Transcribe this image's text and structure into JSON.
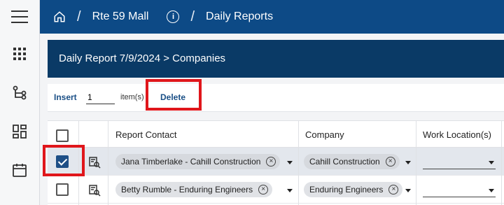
{
  "breadcrumb": {
    "project": "Rte 59 Mall",
    "page": "Daily Reports",
    "sep": "/"
  },
  "page_title": "Daily Report 7/9/2024 > Companies",
  "toolbar": {
    "insert_label": "Insert",
    "quantity": "1",
    "items_label": "item(s)",
    "delete_label": "Delete"
  },
  "table": {
    "columns": [
      "Report Contact",
      "Company",
      "Work Location(s)"
    ],
    "rows": [
      {
        "selected": true,
        "contact": "Jana Timberlake  - Cahill Construction",
        "company": "Cahill Construction",
        "work_location": ""
      },
      {
        "selected": false,
        "contact": "Betty Rumble - Enduring Engineers",
        "company": "Enduring Engineers",
        "work_location": ""
      }
    ]
  },
  "icons": {
    "menu": "hamburger-menu-icon",
    "home": "home-icon",
    "info": "info-icon",
    "sidebar": [
      "apps-grid-icon",
      "hierarchy-icon",
      "dashboard-icon",
      "calendar-icon"
    ],
    "row_action": "view-details-icon",
    "chip_remove": "remove-circle-icon",
    "dropdown": "caret-down-icon"
  },
  "colors": {
    "topbar": "#0d4a86",
    "header": "#0a3a66",
    "highlight": "#e0161b",
    "selected_row": "#e3e7ed",
    "link": "#1a4f86"
  }
}
